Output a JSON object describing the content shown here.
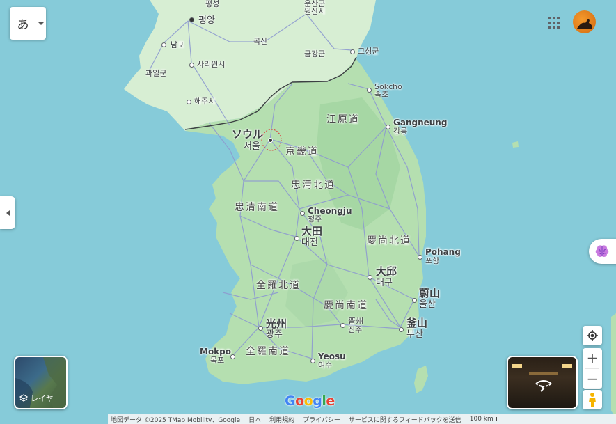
{
  "map": {
    "labels": {
      "pyongsong": "평성",
      "onsan": "원산시",
      "onsan_partial": "운산군",
      "pyongyang": "평양",
      "nampo": "남포",
      "goksan": "곡산",
      "gwail": "과일군",
      "sariwon": "사리원시",
      "geumgang": "금강군",
      "goseong": "고성군",
      "haeju": "해주시",
      "sokcho_en": "Sokcho",
      "sokcho_ko": "속초",
      "gangwon": "江原道",
      "gangneung_en": "Gangneung",
      "gangneung_ko": "강릉",
      "seoul_ja": "ソウル",
      "seoul_ko": "서울",
      "gyeonggi": "京畿道",
      "chungbuk": "忠清北道",
      "chungnam": "忠清南道",
      "cheongju_en": "Cheongju",
      "cheongju_ko": "청주",
      "daejeon_ja": "大田",
      "daejeon_ko": "대전",
      "gyeongbuk": "慶尚北道",
      "pohang_en": "Pohang",
      "pohang_ko": "포항",
      "daegu_ja": "大邱",
      "daegu_ko": "대구",
      "jeonbuk": "全羅北道",
      "ulsan_ja": "蔚山",
      "ulsan_ko": "울산",
      "gyeongnam": "慶尚南道",
      "gwangju_ja": "光州",
      "gwangju_ko": "광주",
      "jinju_ja": "晋州",
      "jinju_ko": "진주",
      "busan_ja": "釜山",
      "busan_ko": "부산",
      "mokpo_en": "Mokpo",
      "mokpo_ko": "목포",
      "jeonnam": "全羅南道",
      "yeosu_en": "Yeosu",
      "yeosu_ko": "여수"
    },
    "colors": {
      "sea": "#86cbd9",
      "land_south": "#b5dfb0",
      "land_north": "#d7eed3",
      "roads": "#8e9bd0",
      "border": "#3c4043"
    }
  },
  "ui": {
    "language_button": "あ",
    "layers_label": "レイヤ",
    "google_logo": [
      "G",
      "o",
      "o",
      "g",
      "l",
      "e"
    ],
    "google_colors": [
      "#4285F4",
      "#EA4335",
      "#FBBC05",
      "#4285F4",
      "#34A853",
      "#EA4335"
    ],
    "zoom_in": "+",
    "zoom_out": "−"
  },
  "footer": {
    "map_data": "地図データ ©2025 TMap Mobility、Google",
    "country": "日本",
    "terms": "利用規約",
    "privacy": "プライバシー",
    "feedback": "サービスに関するフィードバックを送信",
    "scale": "100 km"
  }
}
